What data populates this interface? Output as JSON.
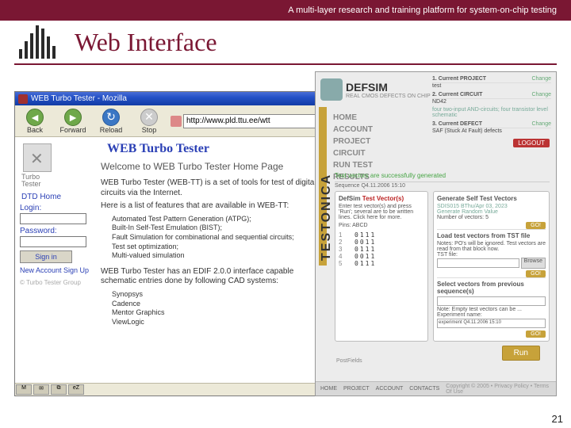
{
  "header": {
    "subtitle": "A multi-layer research and training platform for system-on-chip testing",
    "title": "Web Interface"
  },
  "page_number": "21",
  "browser": {
    "window_title": "WEB Turbo Tester - Mozilla",
    "toolbar": {
      "back": "Back",
      "forward": "Forward",
      "reload": "Reload",
      "stop": "Stop"
    },
    "address": "http://www.pld.ttu.ee/wtt",
    "page": {
      "heading": "WEB Turbo Tester",
      "welcome": "Welcome to WEB Turbo Tester Home Page",
      "intro": "WEB Turbo Tester (WEB-TT) is a set of tools for test of digital circuits via the Internet.",
      "features_lead": "Here is a list of features that are available in WEB-TT:",
      "features": [
        "Automated Test Pattern Generation (ATPG);",
        "Built-In Self-Test Emulation (BIST);",
        "Fault Simulation for combinational and sequential circuits;",
        "Test set optimization;",
        "Multi-valued simulation"
      ],
      "edif_para": "WEB Turbo Tester has an EDIF 2.0.0 interface capable schematic entries done by following CAD systems:",
      "vendors": [
        "Synopsys",
        "Cadence",
        "Mentor Graphics",
        "ViewLogic"
      ],
      "nav": {
        "brand_top": "Turbo",
        "brand_bottom": "Tester",
        "home": "DTD Home",
        "login_label": "Login:",
        "password_label": "Password:",
        "signin": "Sign in",
        "signup": "New Account Sign Up",
        "copyright": "© Turbo Tester Group"
      }
    }
  },
  "testonica": {
    "brand": "TESTONICA",
    "app": "DEFSIM",
    "app_sub": "REAL CMOS DEFECTS ON CHIP",
    "context": {
      "project_label": "1. Current PROJECT",
      "project_val": "test",
      "circuit_label": "2. Current CIRCUIT",
      "circuit_val": "ND42",
      "circuit_note": "four two-input AND-circuits; four transistor level schematic",
      "defect_label": "3. Current DEFECT",
      "defect_val": "SAF (Stuck At Fault) defects",
      "change": "Change"
    },
    "menu": [
      "HOME",
      "ACCOUNT",
      "PROJECT",
      "CIRCUIT",
      "RUN TEST",
      "RESULTS"
    ],
    "logout": "LOGOUT",
    "status": "Test vectors are successfully generated",
    "sequence": "Sequence Q4.11.2006 15:10",
    "left_panel": {
      "title_prefix": "DefSim ",
      "title_red": "Test Vector(s)",
      "desc": "Enter test vector(s) and press 'Run'; several are to be written lines. Click here for more.",
      "pins": "Pins: ABCD"
    },
    "right_panel": {
      "gen_title": "Generate Self Test Vectors",
      "gen_sub": "SDIS015 BThu/Apr 03, 2023",
      "gen_link": "Generate Random Value",
      "count_label": "Number of vectors:",
      "count_val": "5",
      "load_title": "Load test vectors from TST file",
      "load_note": "Notes: PO's will be ignored. Test vectors are read from that block now.",
      "file_label": "TST file:",
      "browse": "Browse",
      "prev_title": "Select vectors from previous sequence(s)",
      "prev_note": "Note: Empty test vectors can be ...",
      "exp_label": "Experiment name:",
      "exp_val": "experiment Q4.11.2006 15:10"
    },
    "table": [
      {
        "n": "1",
        "v": "0111"
      },
      {
        "n": "2",
        "v": "0011"
      },
      {
        "n": "3",
        "v": "0111"
      },
      {
        "n": "4",
        "v": "0011"
      },
      {
        "n": "5",
        "v": "0111"
      }
    ],
    "proc_label": "PostFields",
    "run": "Run",
    "go": "GO!",
    "footer": {
      "links": [
        "HOME",
        "PROJECT",
        "ACCOUNT",
        "CONTACTS"
      ],
      "copy": "Copyright © 2005 • Privacy Policy • Terms Of Use"
    }
  }
}
